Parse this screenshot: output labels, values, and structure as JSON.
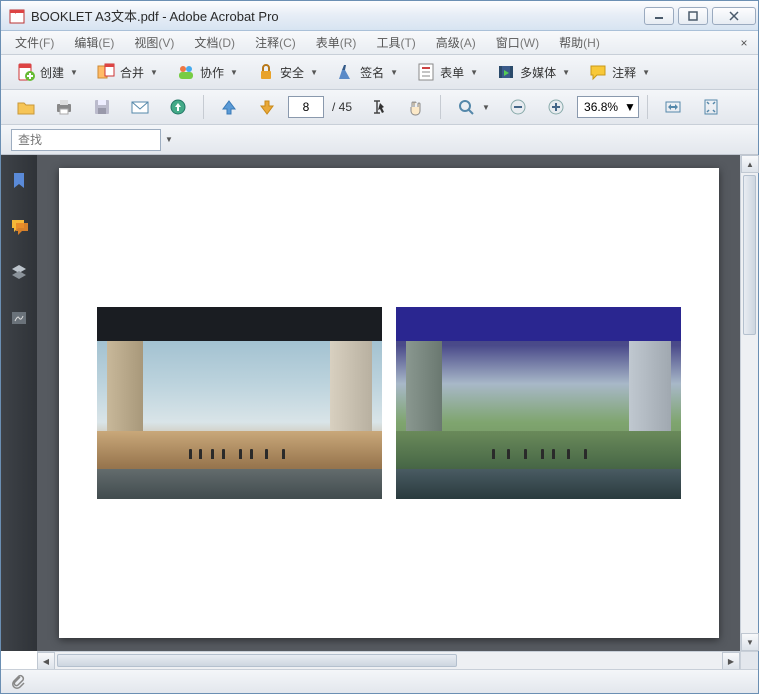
{
  "titlebar": {
    "document_name": "BOOKLET A3文本.pdf",
    "app_name": "Adobe Acrobat Pro",
    "separator": " - "
  },
  "menus": [
    {
      "label": "文件",
      "hotkey": "(F)"
    },
    {
      "label": "编辑",
      "hotkey": "(E)"
    },
    {
      "label": "视图",
      "hotkey": "(V)"
    },
    {
      "label": "文档",
      "hotkey": "(D)"
    },
    {
      "label": "注释",
      "hotkey": "(C)"
    },
    {
      "label": "表单",
      "hotkey": "(R)"
    },
    {
      "label": "工具",
      "hotkey": "(T)"
    },
    {
      "label": "高级",
      "hotkey": "(A)"
    },
    {
      "label": "窗口",
      "hotkey": "(W)"
    },
    {
      "label": "帮助",
      "hotkey": "(H)"
    }
  ],
  "toolbar1": {
    "create": "创建",
    "combine": "合并",
    "collaborate": "协作",
    "secure": "安全",
    "sign": "签名",
    "forms": "表单",
    "multimedia": "多媒体",
    "comment": "注释"
  },
  "toolbar2": {
    "page_current": "8",
    "page_total": "/ 45",
    "zoom_value": "36.8%"
  },
  "findbar": {
    "placeholder": "查找"
  }
}
